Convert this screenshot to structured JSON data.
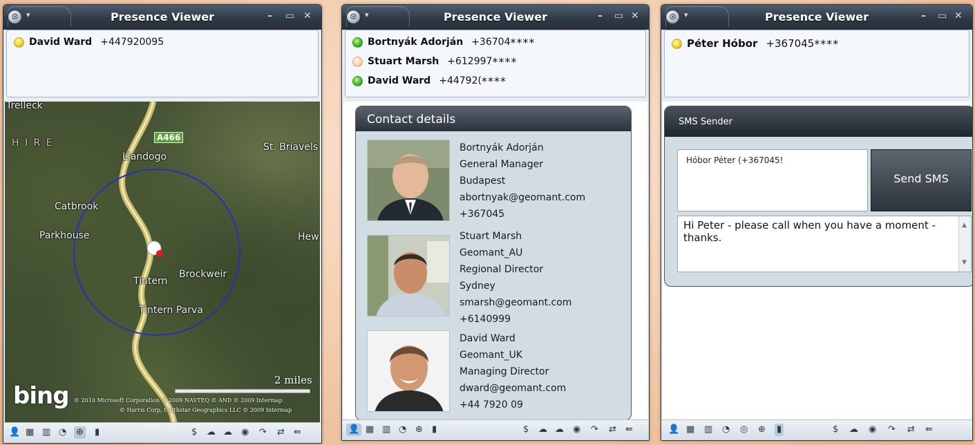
{
  "windows": [
    {
      "title": "Presence Viewer",
      "controls": {
        "minimize": "–",
        "maximize": "▭",
        "close": "✕"
      },
      "contacts": [
        {
          "status": "yellow",
          "name": "David Ward",
          "number": "+447920095",
          "masked": ""
        }
      ],
      "map": {
        "labels": [
          "Trelleck",
          "H I R E",
          "Llandogo",
          "St. Briavels",
          "Catbrook",
          "Parkhouse",
          "Hew",
          "Tintern",
          "Brockweir",
          "Tintern Parva"
        ],
        "road_sign": "A466",
        "scale": "2 miles",
        "logo": "bing",
        "copyright_1": "© 2010 Microsoft Corporation   © 2009 NAVTEQ   © AND   © 2009 Intermap",
        "copyright_2": "© Harris Corp, Earthstar Geographics LLC   © 2009 Intermap"
      }
    },
    {
      "title": "Presence Viewer",
      "controls": {
        "minimize": "–",
        "maximize": "▭",
        "close": "✕"
      },
      "contacts": [
        {
          "status": "green",
          "name": "Bortnyák Adorján",
          "number": "+36704",
          "masked": "****"
        },
        {
          "status": "peach",
          "name": "Stuart Marsh",
          "number": "+612997",
          "masked": "****"
        },
        {
          "status": "green",
          "name": "David Ward",
          "number": "+44792(",
          "masked": "****"
        }
      ],
      "details": {
        "header": "Contact details",
        "people": [
          {
            "lines": [
              "Bortnyák Adorján",
              "General Manager",
              "Budapest",
              "abortnyak@geomant.com",
              "+367045"
            ]
          },
          {
            "lines": [
              "Stuart Marsh",
              "Geomant_AU",
              "Regional Director",
              "Sydney",
              "smarsh@geomant.com",
              "+6140999"
            ]
          },
          {
            "lines": [
              "David Ward",
              "Geomant_UK",
              "Managing Director",
              "dward@geomant.com",
              "+44 7920 09"
            ]
          }
        ]
      }
    },
    {
      "title": "Presence Viewer",
      "controls": {
        "minimize": "–",
        "maximize": "▭",
        "close": "✕"
      },
      "contacts": [
        {
          "status": "yellow",
          "name": "Péter Hóbor",
          "number": "+367045",
          "masked": "****"
        }
      ],
      "sms": {
        "header": "SMS Sender",
        "recipient": "Hóbor Péter (+367045!",
        "send_label": "Send SMS",
        "message": "Hi Peter - please call when you have a moment - thanks."
      }
    }
  ],
  "toolbar_icons": {
    "contacts": "user-icon",
    "grid": "grid-icon",
    "bar-chart": "bar-chart-icon",
    "pie-chart": "pie-chart-icon",
    "target": "target-icon",
    "globe": "globe-icon",
    "phone": "phone-icon",
    "dollar": "dollar-icon",
    "cloud": "cloud-icon",
    "radio": "radio-icon",
    "turn": "turn-icon",
    "swap": "swap-icon",
    "back": "back-icon"
  },
  "colors": {
    "accent": "#2e3a48",
    "available": "#45c02a",
    "away": "#f3d33a"
  }
}
